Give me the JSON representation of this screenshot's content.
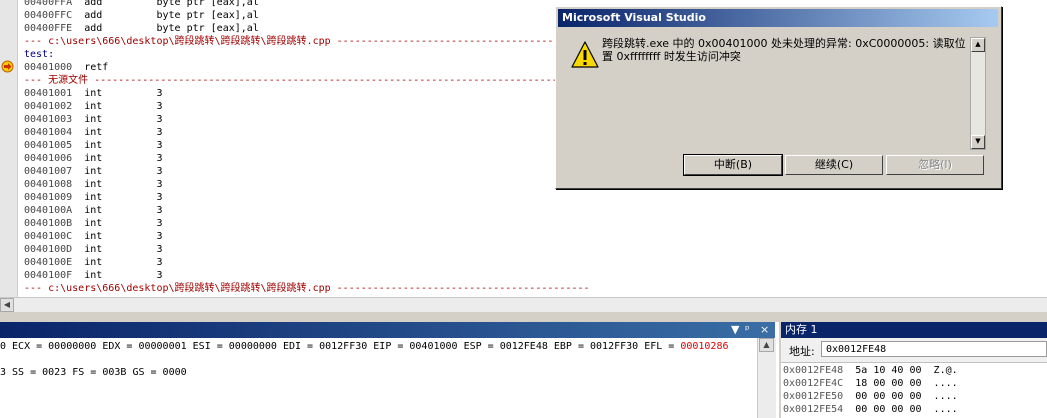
{
  "disassembly": {
    "lines": [
      {
        "addr": "00400FFA",
        "op": "add",
        "args": "byte ptr [eax],al"
      },
      {
        "addr": "00400FFC",
        "op": "add",
        "args": "byte ptr [eax],al"
      },
      {
        "addr": "00400FFE",
        "op": "add",
        "args": "byte ptr [eax],al"
      }
    ],
    "source_sep_top": "--- c:\\users\\666\\desktop\\跨段跳转\\跨段跳转\\跨段跳转.cpp ------------------------------------------",
    "label": "test:",
    "current": {
      "addr": "00401000",
      "op": "retf",
      "args": ""
    },
    "no_source_sep": "--- 无源文件 -----------------------------------------------------------------------------",
    "int_lines": [
      {
        "addr": "00401001",
        "op": "int",
        "args": "3"
      },
      {
        "addr": "00401002",
        "op": "int",
        "args": "3"
      },
      {
        "addr": "00401003",
        "op": "int",
        "args": "3"
      },
      {
        "addr": "00401004",
        "op": "int",
        "args": "3"
      },
      {
        "addr": "00401005",
        "op": "int",
        "args": "3"
      },
      {
        "addr": "00401006",
        "op": "int",
        "args": "3"
      },
      {
        "addr": "00401007",
        "op": "int",
        "args": "3"
      },
      {
        "addr": "00401008",
        "op": "int",
        "args": "3"
      },
      {
        "addr": "00401009",
        "op": "int",
        "args": "3"
      },
      {
        "addr": "0040100A",
        "op": "int",
        "args": "3"
      },
      {
        "addr": "0040100B",
        "op": "int",
        "args": "3"
      },
      {
        "addr": "0040100C",
        "op": "int",
        "args": "3"
      },
      {
        "addr": "0040100D",
        "op": "int",
        "args": "3"
      },
      {
        "addr": "0040100E",
        "op": "int",
        "args": "3"
      },
      {
        "addr": "0040100F",
        "op": "int",
        "args": "3"
      }
    ],
    "source_sep_bottom": "--- c:\\users\\666\\desktop\\跨段跳转\\跨段跳转\\跨段跳转.cpp ------------------------------------------"
  },
  "registers": {
    "title_controls": [
      "▼",
      "ᵖ",
      "×"
    ],
    "line1_prefix": "0 ECX = 00000000 EDX = 00000001 ESI = 00000000 EDI = 0012FF30 EIP = 00401000 ESP = 0012FE48 EBP = 0012FF30 EFL = ",
    "efl_value": "00010286",
    "line2": "3 SS = 0023 FS = 003B GS = 0000"
  },
  "memory": {
    "title": "内存 1",
    "address_label": "地址:",
    "address_value": "0x0012FE48",
    "rows": [
      {
        "addr": "0x0012FE48",
        "bytes": "5a 10 40 00",
        "ascii": "Z.@."
      },
      {
        "addr": "0x0012FE4C",
        "bytes": "18 00 00 00",
        "ascii": "...."
      },
      {
        "addr": "0x0012FE50",
        "bytes": "00 00 00 00",
        "ascii": "...."
      },
      {
        "addr": "0x0012FE54",
        "bytes": "00 00 00 00",
        "ascii": "...."
      }
    ]
  },
  "dialog": {
    "title": "Microsoft Visual Studio",
    "message": "跨段跳转.exe 中的 0x00401000 处未处理的异常: 0xC0000005: 读取位置 0xffffffff 时发生访问冲突",
    "buttons": {
      "break": "中断(B)",
      "continue": "继续(C)",
      "ignore": "忽略(I)"
    },
    "icon": "warning-icon"
  },
  "colors": {
    "separator": "#a00000",
    "efl_changed": "#e00000",
    "title_bar": "#0a246a"
  }
}
